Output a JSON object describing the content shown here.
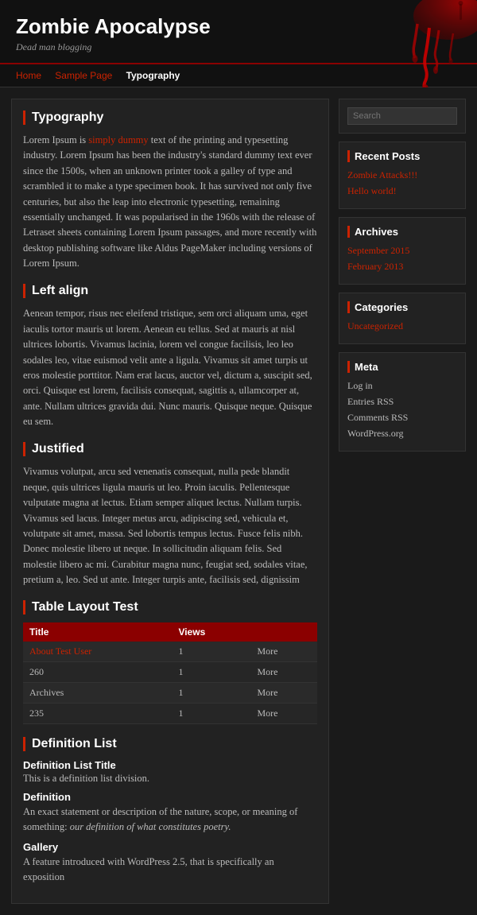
{
  "header": {
    "title": "Zombie Apocalypse",
    "tagline": "Dead man blogging"
  },
  "nav": {
    "items": [
      {
        "label": "Home",
        "active": false
      },
      {
        "label": "Sample Page",
        "active": false
      },
      {
        "label": "Typography",
        "active": true
      }
    ]
  },
  "main": {
    "page_title": "Typography",
    "intro_para1_before": "Lorem Ipsum is ",
    "intro_highlight": "simply dummy",
    "intro_para1_after": " text of the printing and typesetting industry. Lorem Ipsum has been the industry's standard dummy text ever since the 1500s, when an unknown printer took a galley of type and scrambled it to make a type specimen book. It has survived not only five centuries, but also the leap into electronic typesetting, remaining essentially unchanged. It was popularised in the 1960s with the release of Letraset sheets containing Lorem Ipsum passages, and more recently with desktop publishing software like Aldus PageMaker including versions of Lorem Ipsum.",
    "left_align_title": "Left align",
    "left_align_para": "Aenean tempor, risus nec eleifend tristique, sem orci aliquam uma, eget iaculis tortor mauris ut lorem. Aenean eu tellus. Sed at mauris at nisl ultrices lobortis. Vivamus lacinia, lorem vel congue facilisis, leo leo sodales leo, vitae euismod velit ante a ligula. Vivamus sit amet turpis ut eros molestie porttitor. Nam erat lacus, auctor vel, dictum a, suscipit sed, orci. Quisque est lorem, facilisis consequat, sagittis a, ullamcorper at, ante. Nullam ultrices gravida dui. Nunc mauris. Quisque neque. Quisque eu sem.",
    "justified_title": "Justified",
    "justified_para": "Vivamus volutpat, arcu sed venenatis consequat, nulla pede blandit neque, quis ultrices ligula mauris ut leo. Proin iaculis. Pellentesque vulputate magna at lectus. Etiam semper aliquet lectus. Nullam turpis. Vivamus sed lacus. Integer metus arcu, adipiscing sed, vehicula et, volutpate sit amet, massa. Sed lobortis tempus lectus. Fusce felis nibh. Donec molestie libero ut neque. In sollicitudin aliquam felis. Sed molestie libero ac mi. Curabitur magna nunc, feugiat sed, sodales vitae, pretium a, leo. Sed ut ante. Integer turpis ante, facilisis sed, dignissim",
    "table_title": "Table Layout Test",
    "table_headers": [
      "Title",
      "Views",
      ""
    ],
    "table_rows": [
      {
        "title": "About Test User",
        "views": "1",
        "action": "More",
        "link": true
      },
      {
        "title": "260",
        "views": "1",
        "action": "More",
        "link": false
      },
      {
        "title": "Archives",
        "views": "1",
        "action": "More",
        "link": false
      },
      {
        "title": "235",
        "views": "1",
        "action": "More",
        "link": false
      }
    ],
    "def_title": "Definition List",
    "def_list_title": "Definition List Title",
    "def_list_desc": "This is a definition list division.",
    "def_term1": "Definition",
    "def_def1_before": "An exact statement or description of the nature, scope, or meaning of something: ",
    "def_def1_em": "our definition of what constitutes poetry.",
    "def_term2": "Gallery",
    "def_def2": "A feature introduced with WordPress 2.5, that is specifically an exposition"
  },
  "sidebar": {
    "search_placeholder": "Search",
    "recent_posts_title": "Recent Posts",
    "recent_posts": [
      {
        "label": "Zombie Attacks!!!"
      },
      {
        "label": "Hello world!"
      }
    ],
    "archives_title": "Archives",
    "archives": [
      {
        "label": "September 2015"
      },
      {
        "label": "February 2013"
      }
    ],
    "categories_title": "Categories",
    "categories": [
      {
        "label": "Uncategorized"
      }
    ],
    "meta_title": "Meta",
    "meta_items": [
      {
        "label": "Log in"
      },
      {
        "label": "Entries RSS"
      },
      {
        "label": "Comments RSS"
      },
      {
        "label": "WordPress.org"
      }
    ]
  }
}
